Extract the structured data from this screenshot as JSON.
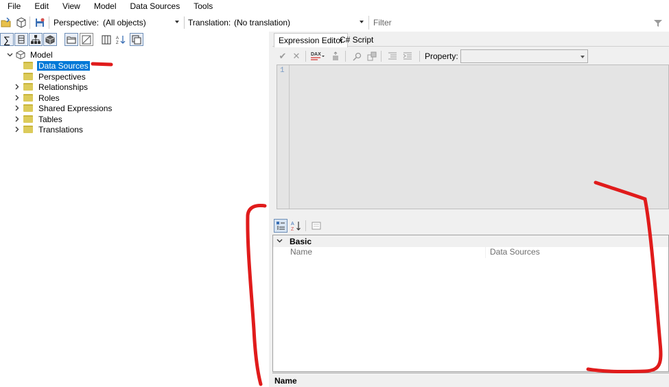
{
  "menu": [
    "File",
    "Edit",
    "View",
    "Model",
    "Data Sources",
    "Tools"
  ],
  "toolbar": {
    "perspective_label": "Perspective:",
    "perspective_value": "(All objects)",
    "translation_label": "Translation:",
    "translation_value": "(No translation)",
    "filter_placeholder": "Filter"
  },
  "tree": {
    "root": "Model",
    "items": [
      {
        "label": "Data Sources",
        "selected": true,
        "expandable": false
      },
      {
        "label": "Perspectives",
        "selected": false,
        "expandable": false
      },
      {
        "label": "Relationships",
        "selected": false,
        "expandable": true
      },
      {
        "label": "Roles",
        "selected": false,
        "expandable": true
      },
      {
        "label": "Shared Expressions",
        "selected": false,
        "expandable": true
      },
      {
        "label": "Tables",
        "selected": false,
        "expandable": true
      },
      {
        "label": "Translations",
        "selected": false,
        "expandable": true
      }
    ]
  },
  "editor": {
    "tabs": [
      "Expression Editor",
      "C# Script"
    ],
    "active_tab": "Expression Editor",
    "property_label": "Property:",
    "property_value": "",
    "line_number": "1",
    "dax_badge": "DAX"
  },
  "property_grid": {
    "category": "Basic",
    "rows": [
      {
        "name": "Name",
        "value": "Data Sources"
      }
    ],
    "description_title": "Name"
  },
  "colors": {
    "selection": "#0078d7",
    "annotation": "#e01b1b",
    "folder": "#dccb5a"
  }
}
